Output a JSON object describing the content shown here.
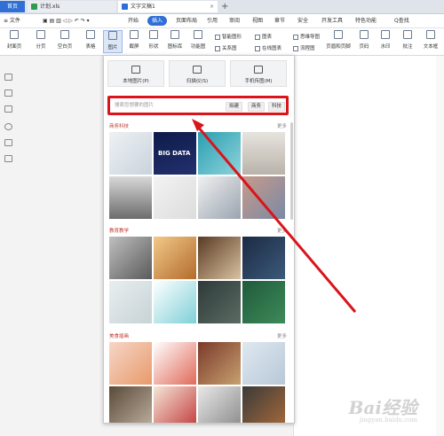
{
  "tabs": {
    "home": "首页",
    "doc1": "计划.xls",
    "doc2": "文字文稿1",
    "plus": "+"
  },
  "menubar": {
    "file": "≡ 文件",
    "items": [
      "开始",
      "插入",
      "页面布局",
      "引用",
      "审阅",
      "视图",
      "章节",
      "安全",
      "开发工具",
      "特色功能"
    ],
    "active_index": 1,
    "search": "Q查找"
  },
  "ribbon": {
    "cover": "封面页",
    "section_break": "分页",
    "blank_page": "空白页",
    "table": "表格",
    "picture": "图片",
    "screenshot": "截屏",
    "shapes": "形状",
    "icon_lib": "图标库",
    "function_chart": "功能图",
    "smart_graphic": "智能图形",
    "chart": "图表",
    "relation_graph": "关系图",
    "online_chart": "在线图表",
    "mind_map": "思维导图",
    "flowchart": "流程图",
    "header_footer": "页眉和页脚",
    "page_number": "页码",
    "watermark": "水印",
    "comment": "批注",
    "textbox": "文本框"
  },
  "panel": {
    "local_picture": "本地图片(P)",
    "scan": "扫描仪(S)",
    "phone_picture": "手机传图(M)",
    "search_placeholder": "搜索您想要的图片",
    "chips": [
      "拟建",
      "商务",
      "科技"
    ],
    "categories": [
      {
        "name": "商务科技",
        "more": "更多"
      },
      {
        "name": "教育教学",
        "more": "更多"
      },
      {
        "name": "美食插画",
        "more": "更多"
      }
    ],
    "big_data_label": "BIG DATA"
  },
  "colors": {
    "accent": "#2f6fd6",
    "highlight_red": "#d9141b",
    "category_red": "#c0392b"
  },
  "watermark": {
    "brand": "Bai经验",
    "url": "jingyan.baidu.com"
  }
}
